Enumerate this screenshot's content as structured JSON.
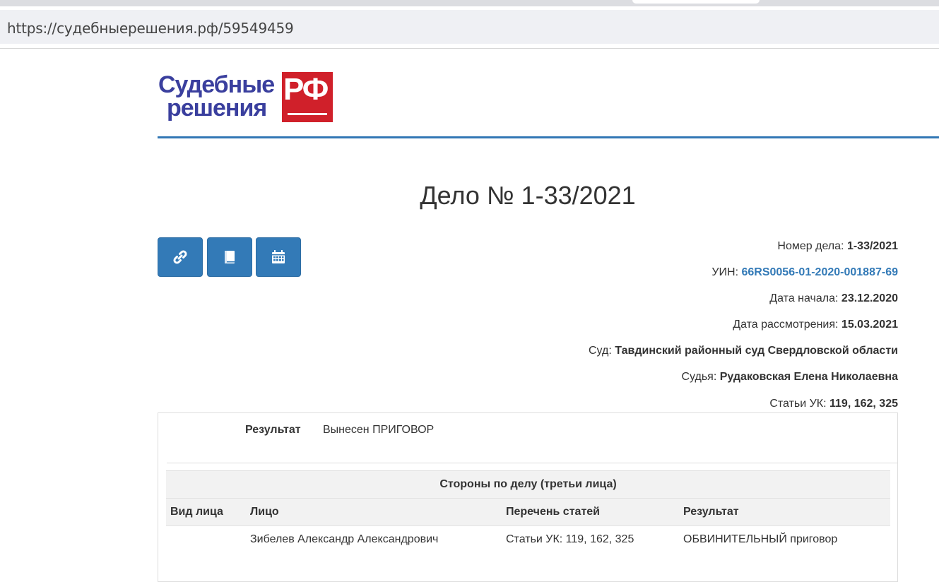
{
  "browser": {
    "url": "https://судебныерешения.рф/59549459"
  },
  "logo": {
    "line1": "Судебные",
    "line2": "решения",
    "badge": "РФ"
  },
  "case": {
    "title": "Дело № 1-33/2021"
  },
  "actions": {
    "link_icon": "link-icon",
    "book_icon": "book-icon",
    "calendar_icon": "calendar-icon"
  },
  "details": {
    "number_label": "Номер дела:",
    "number_value": "1-33/2021",
    "uin_label": "УИН:",
    "uin_value": "66RS0056-01-2020-001887-69",
    "start_label": "Дата начала:",
    "start_value": "23.12.2020",
    "review_label": "Дата рассмотрения:",
    "review_value": "15.03.2021",
    "court_label": "Суд:",
    "court_value": "Тавдинский районный суд Свердловской области",
    "judge_label": "Судья:",
    "judge_value": "Рудаковская Елена Николаевна",
    "articles_label": "Статьи УК:",
    "articles_value": "119, 162, 325"
  },
  "result": {
    "label": "Результат",
    "value": "Вынесен ПРИГОВОР"
  },
  "parties": {
    "caption": "Стороны по делу (третьи лица)",
    "columns": [
      "Вид лица",
      "Лицо",
      "Перечень статей",
      "Результат"
    ],
    "rows": [
      [
        "",
        "Зибелев Александр Александрович",
        "Статьи УК: 119, 162, 325",
        "ОБВИНИТЕЛЬНЫЙ приговор"
      ]
    ]
  },
  "colors": {
    "brand_blue": "#3a3f9e",
    "brand_red": "#d0202a",
    "button_blue": "#337ab7",
    "link_blue": "#337ab7"
  }
}
